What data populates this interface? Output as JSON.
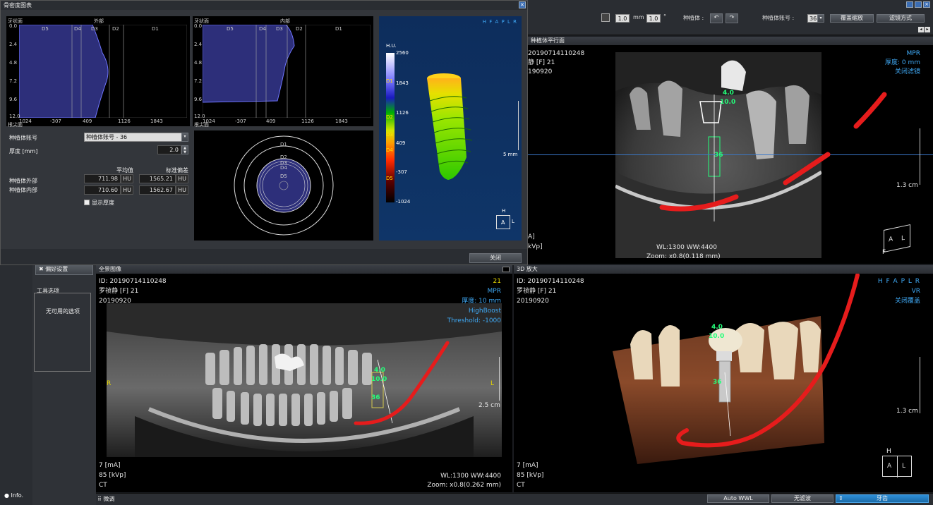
{
  "dialog": {
    "title": "骨密度图表",
    "outer_graph": {
      "title": "外部",
      "left_axis_label": "牙状面",
      "zone_labels": [
        "D5",
        "D4",
        "D3",
        "D2",
        "D1"
      ],
      "y_ticks": [
        "0.0",
        "2.4",
        "4.8",
        "7.2",
        "9.6",
        "12.0"
      ],
      "x_ticks": [
        "1024",
        "-307",
        "409",
        "1126",
        "1843"
      ],
      "bottom_axis_label": "根尖面"
    },
    "inner_graph": {
      "title": "内部",
      "left_axis_label": "牙状面",
      "zone_labels": [
        "D5",
        "D4",
        "D3",
        "D2",
        "D1"
      ],
      "y_ticks": [
        "0.0",
        "2.4",
        "4.8",
        "7.2",
        "9.6",
        "12.0"
      ],
      "x_ticks": [
        "1024",
        "-307",
        "409",
        "1126",
        "1843"
      ],
      "bottom_axis_label": "根尖面"
    },
    "implant_no_label": "种植体账号",
    "implant_no_value": "种植体账号 -  36",
    "thickness_label": "厚度 [mm]",
    "thickness_value": "2.0",
    "col_mean": "平均值",
    "col_std": "标准偏差",
    "row_outer": "种植体外部",
    "row_inner": "种植体内部",
    "outer_mean": "711.98",
    "outer_std": "1565.21",
    "inner_mean": "710.60",
    "inner_std": "1562.67",
    "unit": "HU",
    "show_thickness": "显示厚度",
    "circle_labels": [
      "D1",
      "D2",
      "D3",
      "D4",
      "D5"
    ],
    "scale_title": "H.U.",
    "scale_ticks": [
      "2560",
      "1843",
      "1126",
      "409",
      "-307",
      "-1024"
    ],
    "scale_zones": [
      "D1",
      "D2",
      "D3",
      "D4",
      "D5"
    ],
    "view_orient": "H F A P L R",
    "scale_mm": "5 mm",
    "cube_top": "H",
    "cube_front": "A",
    "cube_side": "L",
    "close_button": "关闭"
  },
  "toolbar": {
    "size_value": "1.0",
    "size_unit": "mm",
    "angle_value": "1.0",
    "angle_unit": "°",
    "implant_label": "种植体 :",
    "implant_no_label": "种植体账号 :",
    "implant_no_value": "36",
    "screen_zoom_button": "覆盖缩放",
    "filter_mode_button": "滤镜方式"
  },
  "top_right": {
    "header": "种植体平行面",
    "id_line": "20190714110248",
    "name_line": "静  [F] 21",
    "date_line": "190920",
    "mode": "MPR",
    "thickness": "厚度: 0 mm",
    "filter": "关闭滤镜",
    "implant_dims_1": "4.0",
    "implant_dims_2": "10.0",
    "implant_no": "36",
    "scale": "1.3 cm",
    "ma": "A]",
    "kvp": "kVp]",
    "wlww": "WL:1300 WW:4400",
    "zoom": "Zoom: x0.8(0.118 mm)",
    "cube_a": "A",
    "cube_l": "L",
    "cube_f": "F"
  },
  "sidebar": {
    "pref_button": "偏好设置",
    "tool_options_title": "工具选项",
    "no_options": "无可用的选项",
    "info_label": "Info."
  },
  "panorama": {
    "header": "全景图像",
    "id_line": "ID: 20190714110248",
    "name_line": "罗祯静  [F] 21",
    "date_line": "20190920",
    "tooth_no": "21",
    "mode": "MPR",
    "thickness": "厚度: 10 mm",
    "highboost": "HighBoost",
    "threshold": "Threshold: -1000",
    "left_marker": "R",
    "right_marker": "L",
    "implant_dims_1": "4.0",
    "implant_dims_2": "10.0",
    "implant_no": "36",
    "scale": "2.5 cm",
    "ma": "7 [mA]",
    "kvp": "85 [kVp]",
    "modality": "CT",
    "wlww": "WL:1300 WW:4400",
    "zoom": "Zoom: x0.8(0.262 mm)"
  },
  "zoom3d": {
    "header": "3D 放大",
    "id_line": "ID: 20190714110248",
    "name_line": "罗祯静  [F] 21",
    "date_line": "20190920",
    "orient": "H F A P L R",
    "mode": "VR",
    "overlay": "关闭覆盖",
    "implant_dims_1": "4.0",
    "implant_dims_2": "10.0",
    "implant_no": "36",
    "scale": "1.3 cm",
    "ma": "7 [mA]",
    "kvp": "85 [kVp]",
    "modality": "CT",
    "cube_h": "H",
    "cube_a": "A",
    "cube_l": "L"
  },
  "bottom": {
    "fine_tune": "微调",
    "auto_wwl": "Auto WWL",
    "no_filter": "无滤波",
    "tooth": "牙齿"
  }
}
